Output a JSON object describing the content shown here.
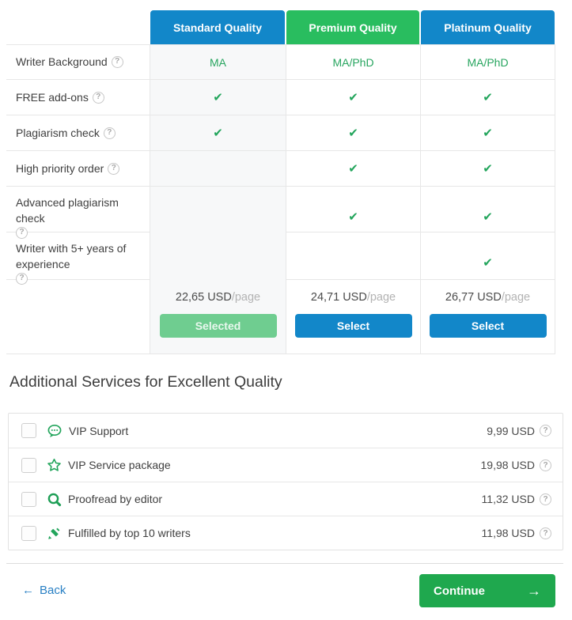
{
  "pricing_table": {
    "columns": [
      {
        "label": "Standard Quality",
        "header_color": "#1287c9",
        "price": "22,65 USD",
        "price_unit": "/page",
        "button_label": "Selected",
        "selected": true
      },
      {
        "label": "Premium Quality",
        "header_color": "#29bd5f",
        "price": "24,71 USD",
        "price_unit": "/page",
        "button_label": "Select",
        "selected": false
      },
      {
        "label": "Platinum Quality",
        "header_color": "#1287c9",
        "price": "26,77 USD",
        "price_unit": "/page",
        "button_label": "Select",
        "selected": false
      }
    ],
    "rows": [
      {
        "label": "Writer Background",
        "values": [
          "MA",
          "MA/PhD",
          "MA/PhD"
        ]
      },
      {
        "label": "FREE add-ons",
        "values": [
          "✔",
          "✔",
          "✔"
        ]
      },
      {
        "label": "Plagiarism check",
        "values": [
          "✔",
          "✔",
          "✔"
        ]
      },
      {
        "label": "High priority order",
        "values": [
          "",
          "✔",
          "✔"
        ]
      },
      {
        "label": "Advanced plagiarism check",
        "values": [
          "",
          "✔",
          "✔"
        ]
      },
      {
        "label": "Writer with 5+ years of experience",
        "values": [
          "",
          "",
          "✔"
        ]
      }
    ]
  },
  "additional_services": {
    "title": "Additional Services for Excellent Quality",
    "items": [
      {
        "label": "VIP Support",
        "price": "9,99 USD",
        "icon": "chat-icon",
        "checked": false
      },
      {
        "label": "VIP Service package",
        "price": "19,98 USD",
        "icon": "star-icon",
        "checked": false
      },
      {
        "label": "Proofread by editor",
        "price": "11,32 USD",
        "icon": "magnifier-icon",
        "checked": false
      },
      {
        "label": "Fulfilled by top 10 writers",
        "price": "11,98 USD",
        "icon": "pencil-icon",
        "checked": false
      }
    ]
  },
  "footer": {
    "back_arrow": "←",
    "back_label": "Back",
    "continue_label": "Continue",
    "continue_arrow": "→"
  },
  "misc": {
    "help_glyph": "?",
    "accent_blue": "#1287c9",
    "accent_green": "#29bd5f",
    "check_green": "#23a55c",
    "selected_green": "#6fcd90",
    "continue_green": "#1fa84e"
  }
}
